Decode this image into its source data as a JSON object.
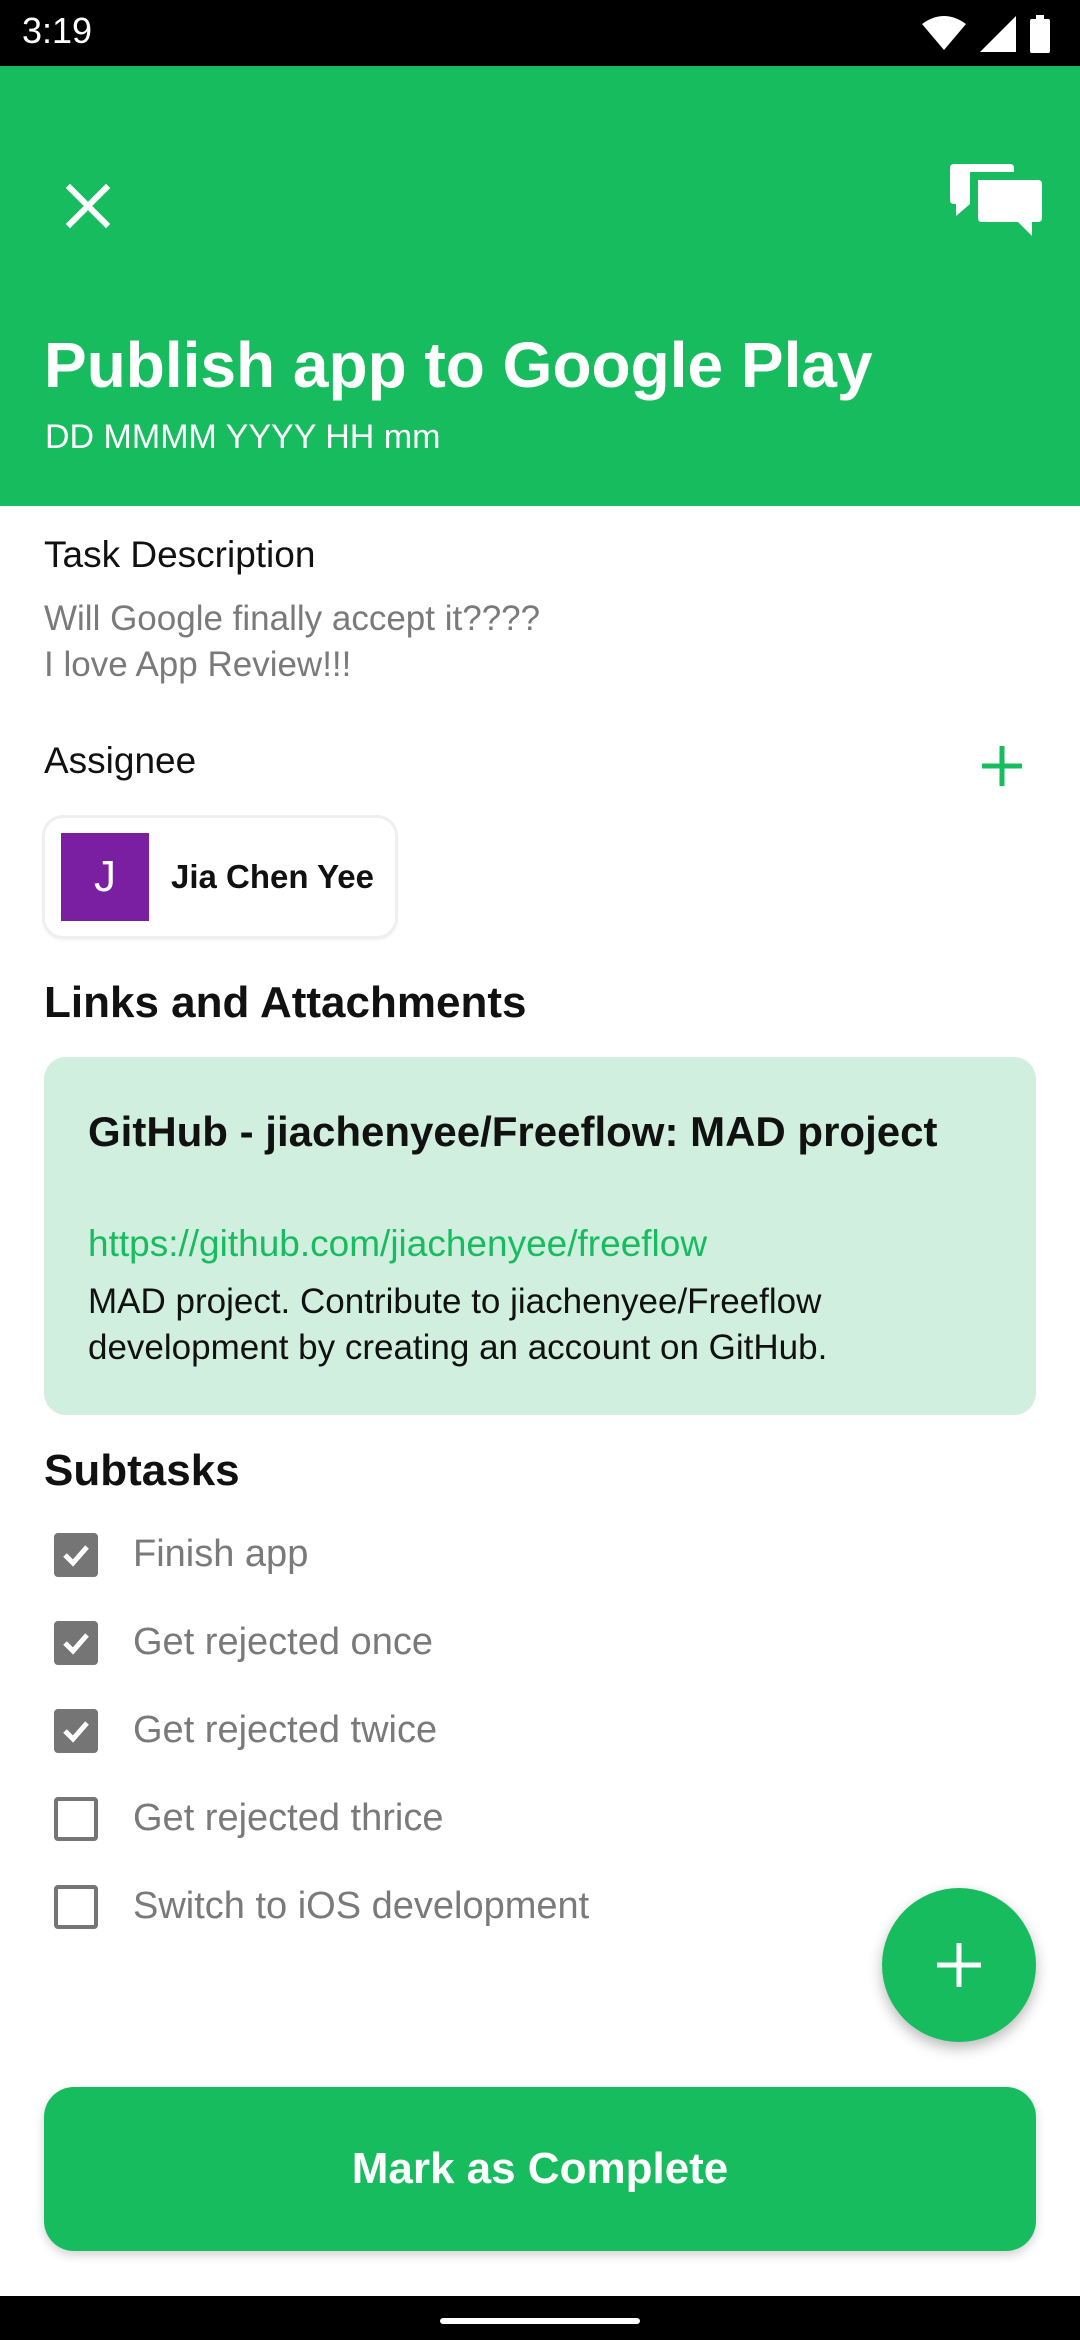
{
  "status_bar": {
    "time": "3:19"
  },
  "task": {
    "title": "Publish app to Google Play",
    "date_placeholder": "DD MMMM YYYY HH mm",
    "description_label": "Task Description",
    "description_lines": [
      "Will Google finally accept it????",
      "I love App Review!!!"
    ]
  },
  "assignee": {
    "label": "Assignee",
    "people": [
      {
        "initial": "J",
        "name": "Jia Chen Yee",
        "color": "#7B1FA2"
      }
    ]
  },
  "links": {
    "heading": "Links and Attachments",
    "items": [
      {
        "title": "GitHub - jiachenyee/Freeflow: MAD project",
        "url": "https://github.com/jiachenyee/freeflow",
        "description": "MAD project. Contribute to jiachenyee/Freeflow development by creating an account on GitHub."
      }
    ]
  },
  "subtasks": {
    "heading": "Subtasks",
    "items": [
      {
        "label": "Finish app",
        "checked": true
      },
      {
        "label": "Get rejected once",
        "checked": true
      },
      {
        "label": "Get rejected twice",
        "checked": true
      },
      {
        "label": "Get rejected thrice",
        "checked": false
      },
      {
        "label": "Switch to iOS development",
        "checked": false
      }
    ]
  },
  "actions": {
    "complete_label": "Mark as Complete"
  },
  "icons": {
    "close": "close-icon",
    "chat": "chat-icon",
    "add": "plus-icon",
    "wifi": "wifi-icon",
    "signal": "signal-icon",
    "battery": "battery-icon"
  },
  "colors": {
    "accent": "#17BC5E",
    "link_card_bg": "#D1EFDF",
    "checkbox": "#757575",
    "avatar": "#7B1FA2"
  }
}
